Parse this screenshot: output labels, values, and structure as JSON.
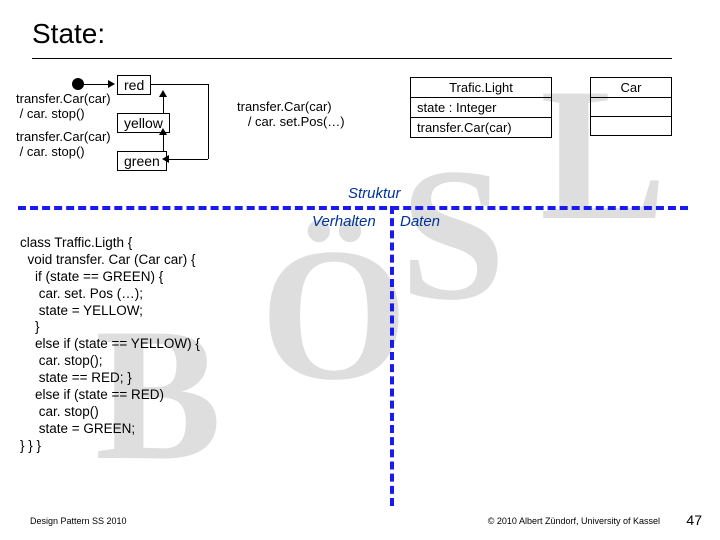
{
  "title": "State:",
  "watermark": {
    "b": "B",
    "o": "Ö",
    "s": "S",
    "l": "L"
  },
  "states": {
    "red": "red",
    "yellow": "yellow",
    "green": "green"
  },
  "transitions": {
    "red_yellow": "transfer.Car(car)\n / car. stop()",
    "yellow_green": "transfer.Car(car)\n / car. stop()",
    "green_red": "transfer.Car(car)\n   / car. set.Pos(…)"
  },
  "uml": {
    "trafic_light": {
      "name": "Trafic.Light",
      "attr": "state : Integer",
      "op": "transfer.Car(car)"
    },
    "car": {
      "name": "Car"
    }
  },
  "axes": {
    "struktur": "Struktur",
    "verhalten": "Verhalten",
    "daten": "Daten"
  },
  "code": "class Traffic.Ligth {\n  void transfer. Car (Car car) {\n    if (state == GREEN) {\n     car. set. Pos (…);\n     state = YELLOW;\n    }\n    else if (state == YELLOW) {\n     car. stop();\n     state == RED; }\n    else if (state == RED)\n     car. stop()\n     state = GREEN;\n} } }",
  "footer": {
    "left": "Design Pattern SS 2010",
    "right": "© 2010 Albert Zündorf, University of Kassel",
    "page": "47"
  }
}
